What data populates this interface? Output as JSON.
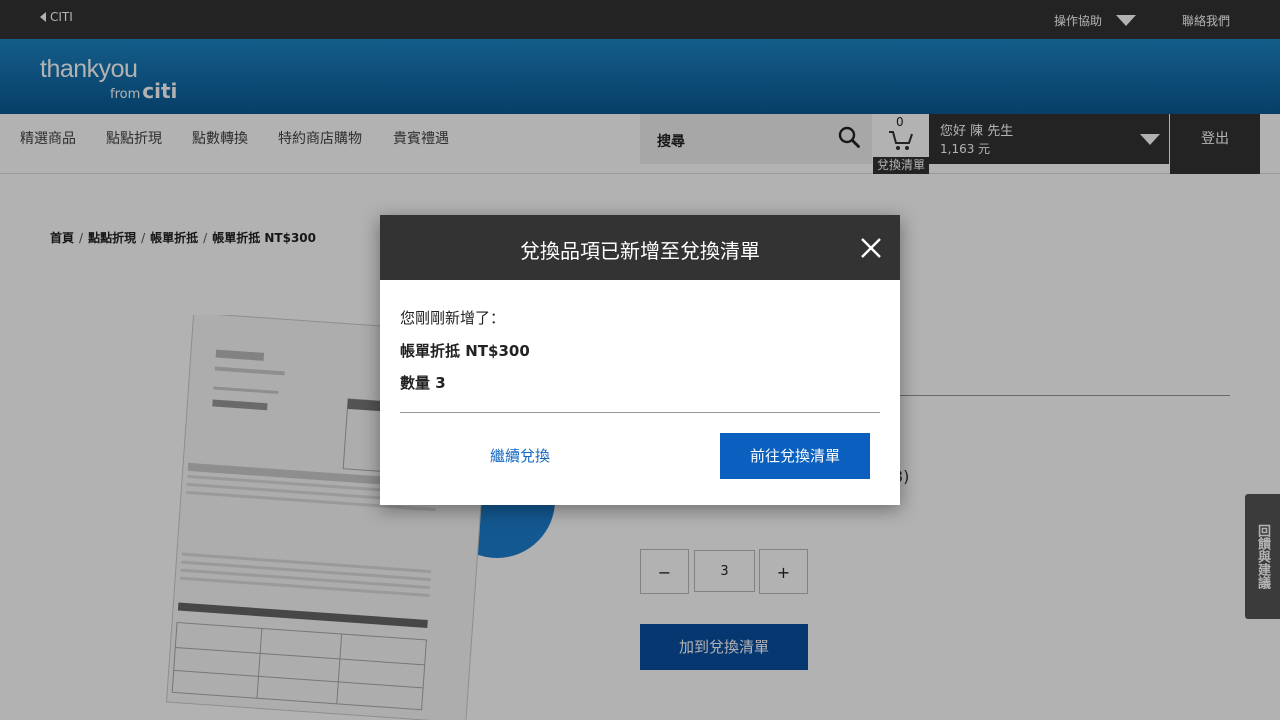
{
  "topbar": {
    "back_label": "CITI",
    "help_label": "操作協助",
    "contact_label": "聯絡我們"
  },
  "header": {
    "logo_main": "thankyou",
    "logo_from": "from",
    "logo_brand": "citi"
  },
  "nav": {
    "items": [
      "精選商品",
      "點點折現",
      "點數轉換",
      "特約商店購物",
      "貴賓禮遇"
    ],
    "search_label": "搜尋",
    "cart_count": "0",
    "cart_label": "兌換清單",
    "greeting": "您好 陳 先生",
    "points": "1,163 元",
    "logout_label": "登出"
  },
  "breadcrumb": {
    "items": [
      "首頁",
      "點點折現",
      "帳單折抵",
      "帳單折抵 NT$300"
    ]
  },
  "product": {
    "partial_text": "3)",
    "qty_minus": "−",
    "qty_value": "3",
    "qty_plus": "+",
    "add_button": "加到兌換清單"
  },
  "feedback_tab": "回饋與建議",
  "modal": {
    "title": "兌換品項已新增至兌換清單",
    "line1": "您剛剛新增了：",
    "line2": "帳單折抵 NT$300",
    "line3": "數量 3",
    "continue_label": "繼續兌換",
    "goto_label": "前往兌換清單"
  },
  "colors": {
    "header_blue": "#1e86c6",
    "button_blue": "#0b5fbe",
    "dark_bar": "#333333"
  }
}
